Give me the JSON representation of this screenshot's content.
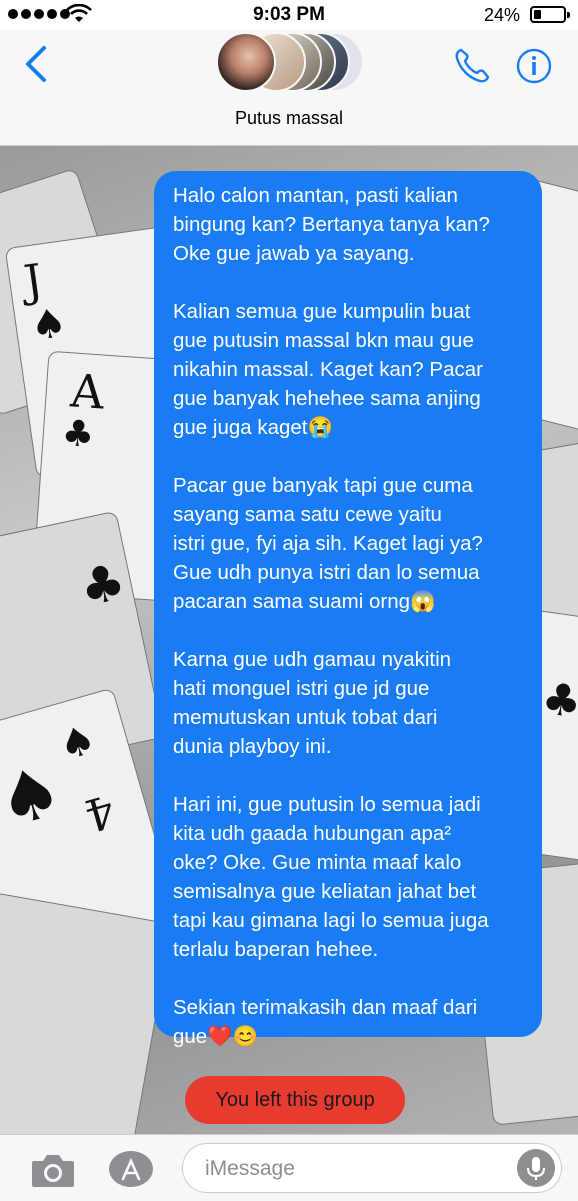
{
  "status_bar": {
    "time": "9:03 PM",
    "battery_percent": "24%",
    "battery_level": 0.24,
    "signal_bars": 5
  },
  "header": {
    "group_name": "Putus massal",
    "back_icon": "chevron-left-icon",
    "call_icon": "phone-icon",
    "info_icon": "info-icon",
    "accent_color": "#1a7cf4"
  },
  "message": {
    "bubble_color": "#1a7cf4",
    "paragraphs": [
      "Halo calon mantan, pasti kalian\nbingung kan? Bertanya tanya kan?\nOke gue jawab ya sayang.",
      "Kalian semua gue kumpulin buat\ngue putusin massal bkn mau gue\nnikahin massal. Kaget kan? Pacar\ngue banyak hehehee sama anjing\ngue juga kaget😭",
      "Pacar gue banyak tapi gue cuma\nsayang sama satu cewe yaitu\nistri gue, fyi aja sih. Kaget lagi ya?\nGue udh punya istri dan lo semua\npacaran sama suami orng😱",
      "Karna gue udh gamau nyakitin\nhati monguel istri gue jd gue\nmemutuskan untuk tobat dari\ndunia playboy ini.",
      "Hari ini, gue putusin lo semua jadi\nkita udh gaada hubungan apa²\noke? Oke. Gue minta maaf kalo\nsemisalnya gue keliatan jahat bet\ntapi kau gimana lagi lo semua juga\nterlalu baperan hehee.",
      "Sekian terimakasih dan maaf dari\ngue❤️😊"
    ]
  },
  "system_notice": {
    "text": "You left this group",
    "color": "#e63b2e"
  },
  "input_bar": {
    "placeholder": "iMessage",
    "value": "",
    "camera_icon": "camera-icon",
    "apps_icon": "app-store-icon",
    "mic_icon": "microphone-icon"
  }
}
